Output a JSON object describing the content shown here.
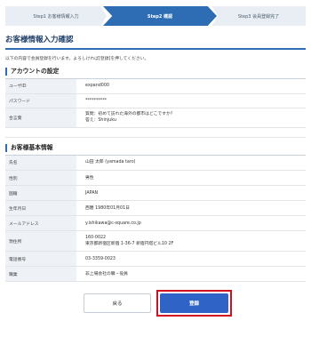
{
  "steps": [
    {
      "label": "Step1 お客様情報入力"
    },
    {
      "label": "Step2 確認"
    },
    {
      "label": "Step3 会員登録完了"
    }
  ],
  "page_title": "お客様情報入力確認",
  "intro": "以下の内容で会員登録を行います。よろしければ[登録]を押してください。",
  "account_section": {
    "title": "アカウントの設定",
    "rows": [
      {
        "label": "ユーザID",
        "lines": [
          "expand000"
        ]
      },
      {
        "label": "パスワード",
        "lines": [
          "**********"
        ]
      },
      {
        "label": "合言葉",
        "lines": [
          "質問：初めて訪れた海外の都市はどこですか？",
          "答え：Shinjuku"
        ]
      }
    ]
  },
  "customer_section": {
    "title": "お客様基本情報",
    "rows": [
      {
        "label": "氏名",
        "lines": [
          "山田 太郎 (yamada taro)"
        ]
      },
      {
        "label": "性別",
        "lines": [
          "男性"
        ]
      },
      {
        "label": "国籍",
        "lines": [
          "JAPAN"
        ]
      },
      {
        "label": "生年月日",
        "lines": [
          "西暦 1980年01月01日"
        ]
      },
      {
        "label": "メールアドレス",
        "lines": [
          "y.ishikawa@c-square.co.jp"
        ]
      },
      {
        "label": "現住所",
        "lines": [
          "160-0022",
          "東京都新宿区新宿 1-36-7 新宿円塔ビル10 2F"
        ]
      },
      {
        "label": "電話番号",
        "lines": [
          "03-3359-0023"
        ]
      },
      {
        "label": "職業",
        "lines": [
          "非上場会社の職・役員"
        ]
      }
    ]
  },
  "buttons": {
    "back": "戻る",
    "register": "登録"
  }
}
